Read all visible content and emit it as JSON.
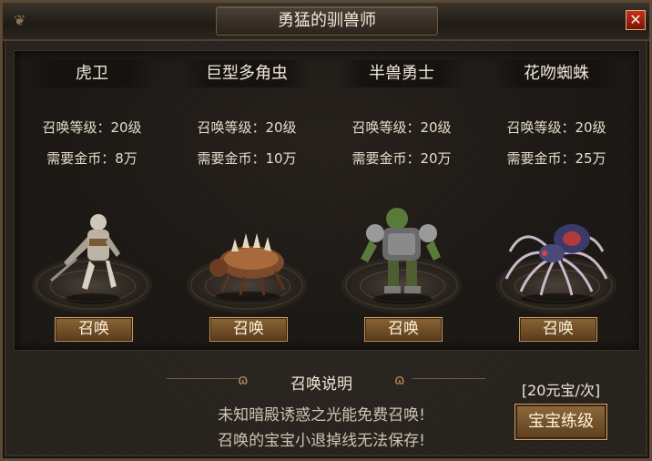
{
  "window": {
    "title": "勇猛的驯兽师",
    "close_label": "✕"
  },
  "monsters": [
    {
      "name": "虎卫",
      "summon_level": "召唤等级：20级",
      "gold_required": "需要金币：8万",
      "button_label": "召唤",
      "icon": "armored-warrior"
    },
    {
      "name": "巨型多角虫",
      "summon_level": "召唤等级：20级",
      "gold_required": "需要金币：10万",
      "button_label": "召唤",
      "icon": "horned-bug"
    },
    {
      "name": "半兽勇士",
      "summon_level": "召唤等级：20级",
      "gold_required": "需要金币：20万",
      "button_label": "召唤",
      "icon": "orc-warrior"
    },
    {
      "name": "花吻蜘蛛",
      "summon_level": "召唤等级：20级",
      "gold_required": "需要金币：25万",
      "button_label": "召唤",
      "icon": "spider"
    }
  ],
  "description": {
    "title": "召唤说明",
    "line1": "未知暗殿诱惑之光能免费召唤!",
    "line2": "召唤的宝宝小退掉线无法保存!"
  },
  "training": {
    "cost": "[20元宝/次]",
    "button_label": "宝宝练级"
  },
  "colors": {
    "button_brown": "#7a5630",
    "button_border": "#c39a60",
    "close_red": "#c33222",
    "text_light": "#efe6d6"
  }
}
